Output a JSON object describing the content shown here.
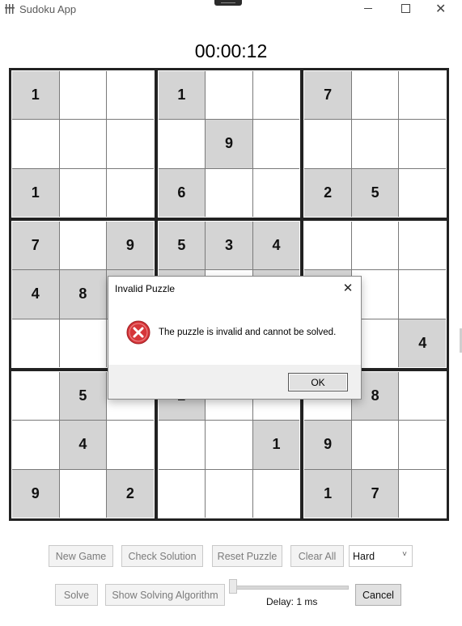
{
  "window": {
    "title": "Sudoku App"
  },
  "timer": "00:00:12",
  "board": {
    "cells": [
      [
        "1",
        "",
        "",
        "1",
        "",
        "",
        "7",
        "",
        ""
      ],
      [
        "",
        "",
        "",
        "",
        "9",
        "",
        "",
        "",
        ""
      ],
      [
        "1",
        "",
        "",
        "6",
        "",
        "",
        "2",
        "5",
        ""
      ],
      [
        "7",
        "",
        "9",
        "5",
        "3",
        "4",
        "",
        "",
        ""
      ],
      [
        "4",
        "8",
        "",
        "",
        "",
        "",
        "",
        "",
        ""
      ],
      [
        "",
        "",
        "",
        "",
        "",
        "",
        "",
        "",
        "4"
      ],
      [
        "",
        "5",
        "",
        "2",
        "",
        "",
        "",
        "8",
        ""
      ],
      [
        "",
        "4",
        "",
        "",
        "",
        "1",
        "9",
        "",
        ""
      ],
      [
        "9",
        "",
        "2",
        "",
        "",
        "",
        "1",
        "7",
        ""
      ]
    ],
    "given": [
      [
        1,
        0,
        0,
        1,
        0,
        0,
        1,
        0,
        0
      ],
      [
        0,
        0,
        0,
        0,
        1,
        0,
        0,
        0,
        0
      ],
      [
        1,
        0,
        0,
        1,
        0,
        0,
        1,
        1,
        0
      ],
      [
        1,
        0,
        1,
        1,
        1,
        1,
        0,
        0,
        0
      ],
      [
        1,
        1,
        1,
        1,
        0,
        1,
        1,
        0,
        0
      ],
      [
        0,
        0,
        0,
        0,
        0,
        0,
        0,
        0,
        1
      ],
      [
        0,
        1,
        0,
        1,
        0,
        0,
        0,
        1,
        0
      ],
      [
        0,
        1,
        0,
        0,
        0,
        1,
        1,
        0,
        0
      ],
      [
        1,
        0,
        1,
        0,
        0,
        0,
        1,
        1,
        0
      ]
    ]
  },
  "dialog": {
    "title": "Invalid Puzzle",
    "message": "The puzzle is invalid and cannot be solved.",
    "ok_label": "OK",
    "icon": "error-icon",
    "close_glyph": "✕"
  },
  "controls": {
    "new_game": "New Game",
    "check_solution": "Check Solution",
    "reset_puzzle": "Reset Puzzle",
    "clear_all": "Clear All",
    "difficulty": "Hard",
    "solve": "Solve",
    "show_algorithm": "Show Solving Algorithm",
    "delay_label": "Delay: 1 ms",
    "delay_value_fraction": 0.0,
    "cancel": "Cancel"
  },
  "colors": {
    "given_bg": "#d4d4d4",
    "error_red": "#d6363a"
  }
}
